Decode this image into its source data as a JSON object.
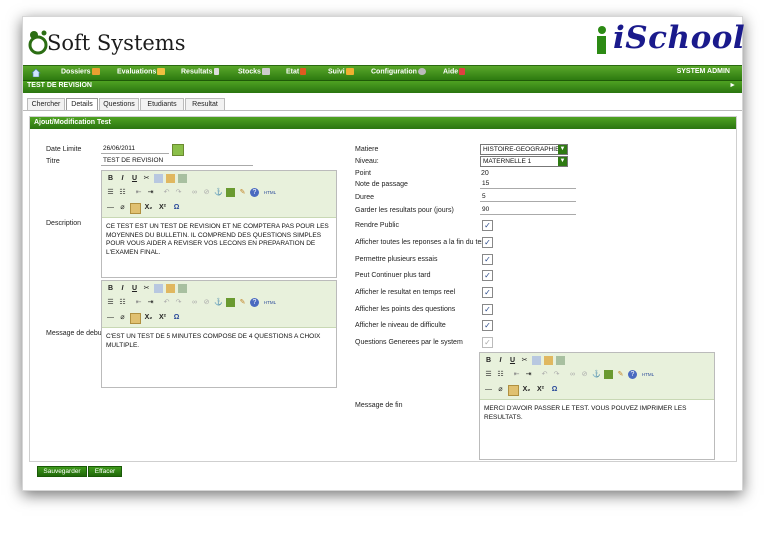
{
  "brand": {
    "left_logo": "Soft Systems",
    "right_logo": "iSchool"
  },
  "nav": {
    "items": [
      "Dossiers",
      "Evaluations",
      "Resultats",
      "Stocks",
      "Etat",
      "Suivi",
      "Configuration",
      "Aide"
    ],
    "user": "SYSTEM ADMIN"
  },
  "page_title": "TEST DE REVISION",
  "tabs": [
    "Chercher",
    "Details",
    "Questions",
    "Etudiants",
    "Resultat"
  ],
  "active_tab": "Details",
  "panel_title": "Ajout/Modification Test",
  "form": {
    "date_limite_label": "Date Limite",
    "date_limite": "26/06/2011",
    "titre_label": "Titre",
    "titre": "TEST DE REVISION",
    "description_label": "Description",
    "description": "CE TEST EST UN TEST DE REVISION ET NE COMPTERA PAS POUR LES MOYENNES DU BULLETIN. IL COMPREND DES QUESTIONS SIMPLES POUR VOUS AIDER A REVISER VOS LECONS EN PREPARATION DE L'EXAMEN FINAL.",
    "message_debut_label": "Message de debut",
    "message_debut": "C'EST UN TEST DE 5 MINUTES COMPOSE DE 4 QUESTIONS A CHOIX MULTIPLE.",
    "matiere_label": "Matiere",
    "matiere": "HISTOIRE-GEOGRAPHIE",
    "niveau_label": "Niveau:",
    "niveau": "MATERNELLE 1",
    "point_label": "Point",
    "point": "20",
    "note_passage_label": "Note de passage",
    "note_passage": "15",
    "duree_label": "Duree",
    "duree": "5",
    "garder_label": "Garder les resultats pour (jours)",
    "garder": "90",
    "checkboxes": [
      {
        "label": "Rendre Public",
        "checked": true
      },
      {
        "label": "Afficher toutes les reponses a la fin du test",
        "checked": true
      },
      {
        "label": "Permettre plusieurs essais",
        "checked": true
      },
      {
        "label": "Peut Continuer plus tard",
        "checked": true
      },
      {
        "label": "Afficher le resultat en temps reel",
        "checked": true
      },
      {
        "label": "Afficher les points des questions",
        "checked": true
      },
      {
        "label": "Afficher le niveau de difficulte",
        "checked": true
      },
      {
        "label": "Questions Generees par le system",
        "checked": true,
        "disabled": true
      }
    ],
    "message_fin_label": "Message de fin",
    "message_fin": "MERCI D'AVOIR PASSER LE TEST. VOUS POUVEZ IMPRIMER LES RESULTATS."
  },
  "toolbar": {
    "bold": "B",
    "italic": "I",
    "underline": "U",
    "subscript": "X₂",
    "superscript": "X²",
    "omega": "Ω",
    "html": "HTML"
  },
  "buttons": {
    "save": "Sauvegarder",
    "clear": "Effacer"
  },
  "colors": {
    "nav_green": "#3a8a18",
    "logo_blue": "#1a1a8c"
  }
}
